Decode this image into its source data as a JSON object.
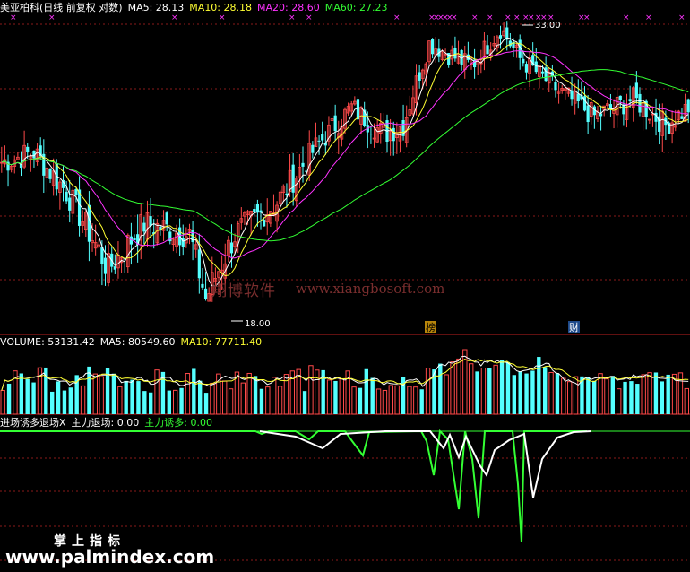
{
  "colors": {
    "up": "#ff4a4a",
    "down": "#54ffff",
    "ma5": "#ffffff",
    "ma10": "#ffff33",
    "ma20": "#ff33ff",
    "ma60": "#33ff33",
    "divider": "#c02020",
    "grid": "#8a1a1a"
  },
  "header": {
    "title": "美亚柏科(日线 前复权 对数)",
    "ma5": "MA5: 28.13",
    "ma10": "MA10: 28.18",
    "ma20": "MA20: 28.60",
    "ma60": "MA60: 27.23"
  },
  "volume_header": {
    "volume": "VOLUME: 53131.42",
    "ma5": "MA5: 80549.60",
    "ma10": "MA10: 77711.40"
  },
  "indicator_header": {
    "name": "进场诱多退场X",
    "main_exit": "主力退场: 0.00",
    "main_lure": "主力诱多: 0.00"
  },
  "annotations": {
    "high_label": "33.00",
    "low_label": "18.00",
    "marker_1": "榜",
    "marker_2": "财"
  },
  "watermark": {
    "cn": "翔博软件",
    "url": "www.xiangbosoft.com"
  },
  "footer": {
    "line1": "掌上指标",
    "line2": "www.palmindex.com"
  },
  "chart_data": [
    {
      "type": "candlestick",
      "title": "美亚柏科(日线 前复权 对数)",
      "ylim": [
        17.5,
        34
      ],
      "y_scale": "log",
      "series": [
        {
          "name": "MA5",
          "last": 28.13
        },
        {
          "name": "MA10",
          "last": 28.18
        },
        {
          "name": "MA20",
          "last": 28.6
        },
        {
          "name": "MA60",
          "last": 27.23
        }
      ],
      "annotations": [
        {
          "label": "33.00",
          "y": 33.0
        },
        {
          "label": "18.00",
          "y": 18.0
        }
      ]
    },
    {
      "type": "bar",
      "title": "VOLUME",
      "series": [
        {
          "name": "VOLUME",
          "last": 53131.42
        },
        {
          "name": "MA5",
          "last": 80549.6
        },
        {
          "name": "MA10",
          "last": 77711.4
        }
      ]
    },
    {
      "type": "line",
      "title": "进场诱多退场X",
      "series": [
        {
          "name": "主力退场",
          "last": 0.0
        },
        {
          "name": "主力诱多",
          "last": 0.0
        }
      ]
    }
  ]
}
